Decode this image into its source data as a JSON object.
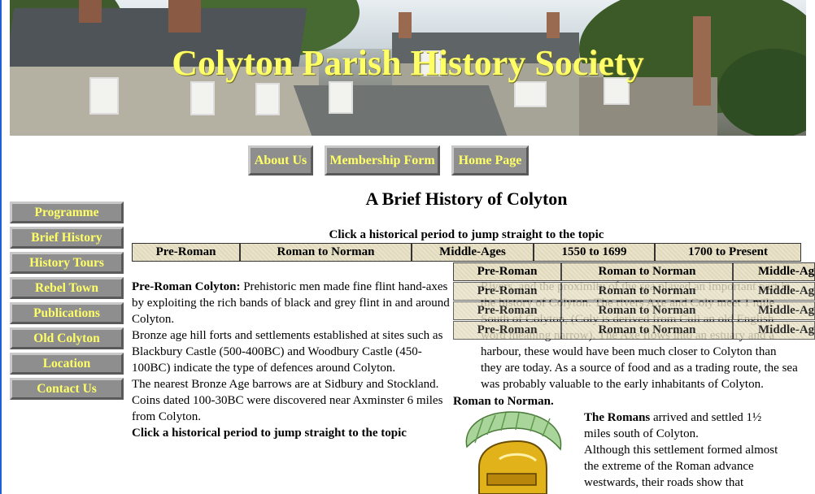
{
  "header": {
    "site_title": "Colyton Parish History Society"
  },
  "top_nav": [
    "About Us",
    "Membership Form",
    "Home Page"
  ],
  "sidebar": {
    "items": [
      "Programme",
      "Brief History",
      "History Tours",
      "Rebel Town",
      "Publications",
      "Old Colyton",
      "Location",
      "Contact Us"
    ]
  },
  "main": {
    "heading": "A Brief History of Colyton",
    "jump_prompt": "Click a historical period to jump straight to the topic",
    "periods": [
      "Pre-Roman",
      "Roman to Norman",
      "Middle-Ages",
      "1550 to 1699",
      "1700 to Present"
    ],
    "overlay_periods": [
      "Pre-Roman",
      "Roman to Norman",
      "Middle-Ages"
    ],
    "pre_roman": {
      "title": "Pre-Roman Colyton:",
      "p1": " Prehistoric men made fine flint hand-axes by exploiting the rich bands of black and grey flint in and around Colyton.",
      "p2": "Bronze age hill forts and settlements  established at sites such as Blackbury Castle (500-400BC) and Woodbury Castle (450-100BC) indicate the type of defences around Colyton.",
      "p3": "The nearest Bronze Age barrows are at Sidbury and Stockland.",
      "p4": "Coins dated 100-30BC were discovered near Axminster 6 miles from Colyton.",
      "jump_again": "Click a historical period to jump straight to the topic"
    },
    "rivers": {
      "text": "Rivers, and the proximity of the sea played an important part in the history of Colyton. The rivers Axe and Coly meet 1 mile South of Colyton, (Coly is derived from Culi an old English word meaning narrow). The Axe flows into an estuary and a harbour, these would have been much closer to Colyton than they are today.  As a source of food and as a trading route, the sea was probably valuable to the early inhabitants of Colyton."
    },
    "roman": {
      "title": "Roman to Norman.",
      "lead_bold": "The Romans",
      "lead_rest": " arrived and settled 1½ miles south of Colyton.",
      "p2": "Although this settlement formed almost the extreme of the Roman advance westwards, their roads show that"
    }
  },
  "colors": {
    "title_yellow": "#ffff66",
    "button_grey": "#8e8e8e",
    "cell_beige": "#e9e2c6"
  }
}
